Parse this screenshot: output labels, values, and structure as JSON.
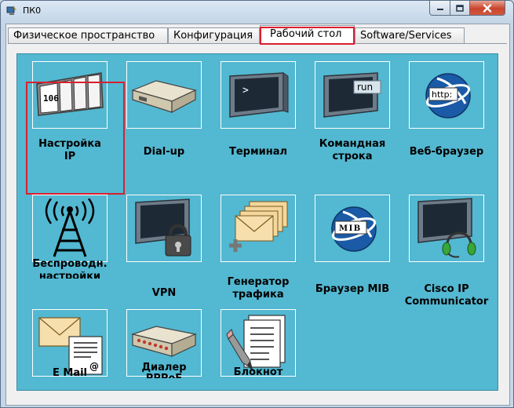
{
  "window": {
    "title": "ПК0",
    "minimize_glyph": "–",
    "maximize_glyph": "□",
    "close_glyph": "✕"
  },
  "tabs": [
    {
      "label": "Физическое пространство",
      "active": false
    },
    {
      "label": "Конфигурация",
      "active": false
    },
    {
      "label": "Рабочий стол",
      "active": true
    },
    {
      "label": "Software/Services",
      "active": false
    }
  ],
  "apps": [
    {
      "label": "Настройка\nIP",
      "icon": "ip-config-icon",
      "tile_text": "106"
    },
    {
      "label": "Dial-up",
      "icon": "modem-icon"
    },
    {
      "label": "Терминал",
      "icon": "terminal-icon",
      "tile_text": ">"
    },
    {
      "label": "Командная\nстрока",
      "icon": "command-prompt-icon",
      "tile_text": "run"
    },
    {
      "label": "Веб-браузер",
      "icon": "web-browser-icon",
      "tile_text": "http:"
    },
    {
      "label": "Беспроводн.\nнастройки",
      "icon": "wireless-tower-icon"
    },
    {
      "label": "VPN",
      "icon": "vpn-lock-icon"
    },
    {
      "label": "Генератор\nтрафика",
      "icon": "traffic-generator-icon"
    },
    {
      "label": "Браузер MIB",
      "icon": "mib-browser-icon",
      "tile_text": "MIB"
    },
    {
      "label": "Cisco IP\nCommunicator",
      "icon": "ip-communicator-icon"
    },
    {
      "label": "E Mail",
      "icon": "email-icon",
      "tile_text": "@"
    },
    {
      "label": "Диалер\nPPPoE",
      "icon": "pppoe-dialer-icon"
    },
    {
      "label": "Блокнот",
      "icon": "notepad-icon"
    }
  ],
  "colors": {
    "desktop_bg": "#53b8d1",
    "highlight": "#d9202f"
  }
}
